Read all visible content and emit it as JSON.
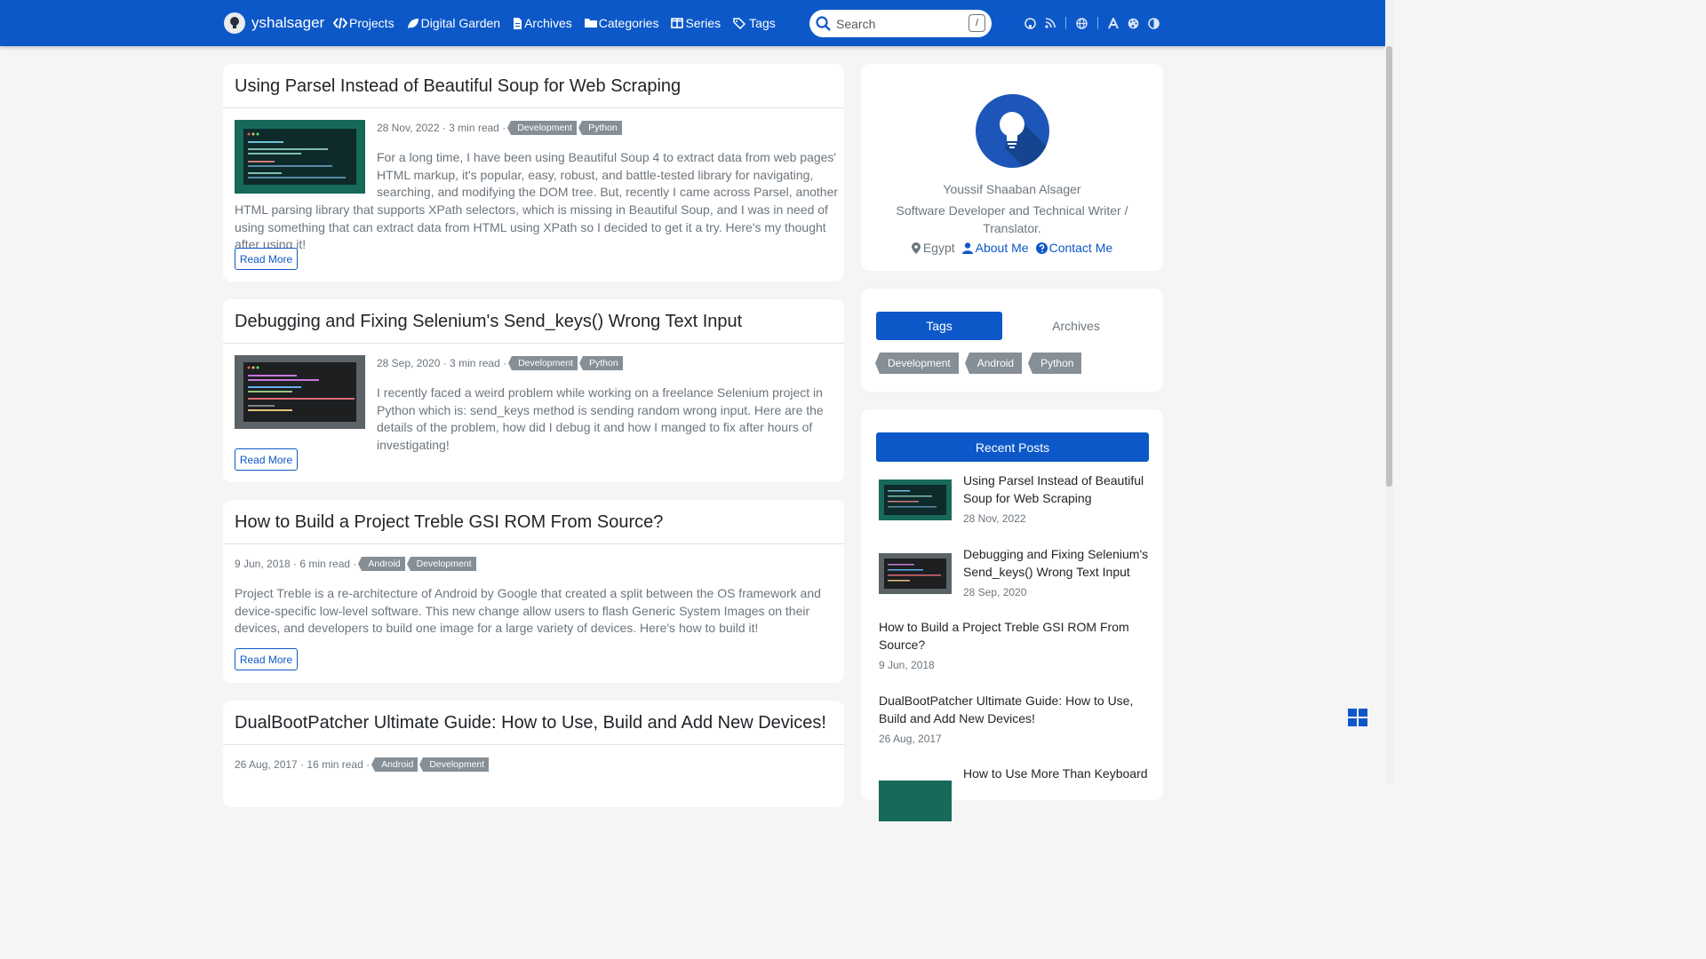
{
  "navbar": {
    "brand": "yshalsager",
    "links": [
      {
        "label": "Projects",
        "icon": "code-icon"
      },
      {
        "label": "Digital Garden",
        "icon": "leaf-icon"
      },
      {
        "label": "Archives",
        "icon": "file-icon"
      },
      {
        "label": "Categories",
        "icon": "folder-icon"
      },
      {
        "label": "Series",
        "icon": "columns-icon"
      },
      {
        "label": "Tags",
        "icon": "tags-icon"
      }
    ],
    "search": {
      "placeholder": "Search",
      "shortcut": "/"
    },
    "tools": [
      "github-icon",
      "rss-icon",
      "globe-icon",
      "font-icon",
      "palette-icon",
      "contrast-icon"
    ],
    "color": "#0d58c8"
  },
  "posts": [
    {
      "title": "Using Parsel Instead of Beautiful Soup for Web Scraping",
      "meta": "28 Nov, 2022 · 3 min read ·",
      "tags": [
        "Development",
        "Python"
      ],
      "excerpt_a": "For a long time, I have been using Beautiful Soup 4 to extract data from web pages' HTML markup, it's popular, easy, robust, and battle-tested library for navigating, searching, and modifying the DOM tree. But, recently I came across Parsel, another",
      "excerpt_b": "HTML parsing library that supports XPath selectors, which is missing in Beautiful Soup, and I was in need of using something that can extract data from HTML using XPath so I decided to get it a try. Here's my thought after using it!",
      "read_more": "Read More"
    },
    {
      "title": "Debugging and Fixing Selenium's Send_keys() Wrong Text Input",
      "meta": "28 Sep, 2020 · 3 min read ·",
      "tags": [
        "Development",
        "Python"
      ],
      "excerpt": "I recently faced a weird problem while working on a freelance Selenium project in Python which is: send_keys method is sending random wrong input. Here are the details of the problem, how did I debug it and how I manged to fix after hours of investigating!",
      "read_more": "Read More"
    },
    {
      "title": "How to Build a Project Treble GSI ROM From Source?",
      "meta": "9 Jun, 2018 · 6 min read ·",
      "tags": [
        "Android",
        "Development"
      ],
      "excerpt": "Project Treble is a re-architecture of Android by Google that created a split between the OS framework and device-specific low-level software. This new change allow users to flash Generic System Images on their devices, and developers to build one image for a large variety of devices. Here's how to build it!",
      "read_more": "Read More"
    },
    {
      "title": "DualBootPatcher Ultimate Guide: How to Use, Build and Add New Devices!",
      "meta": "26 Aug, 2017 · 16 min read ·",
      "tags": [
        "Android",
        "Development"
      ]
    }
  ],
  "profile": {
    "name": "Youssif Shaaban Alsager",
    "bio": "Software Developer and Technical Writer / Translator.",
    "location": "Egypt",
    "about": "About Me",
    "contact": "Contact Me"
  },
  "taxonomy": {
    "tabs": [
      "Tags",
      "Archives"
    ],
    "active_tab": "Tags",
    "tags": [
      "Development",
      "Android",
      "Python"
    ]
  },
  "recent": {
    "header": "Recent Posts",
    "items": [
      {
        "title": "Using Parsel Instead of Beautiful Soup for Web Scraping",
        "date": "28 Nov, 2022"
      },
      {
        "title": "Debugging and Fixing Selenium's Send_keys() Wrong Text Input",
        "date": "28 Sep, 2020"
      },
      {
        "title": "How to Build a Project Treble GSI ROM From Source?",
        "date": "9 Jun, 2018"
      },
      {
        "title": "DualBootPatcher Ultimate Guide: How to Use, Build and Add New Devices!",
        "date": "26 Aug, 2017"
      },
      {
        "title": "How to Use More Than Keyboard",
        "date": ""
      }
    ]
  }
}
